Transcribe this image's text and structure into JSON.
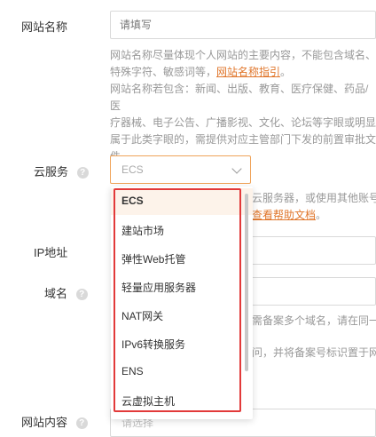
{
  "form": {
    "site_name": {
      "label": "网站名称",
      "placeholder": "请填写",
      "desc_lines": [
        "网站名称尽量体现个人网站的主要内容，不能包含域名、",
        "特殊字符、敏感词等，",
        "网站名称若包含：新闻、出版、教育、医疗保健、药品/医",
        "疗器械、电子公告、广播影视、文化、论坛等字眼或明显",
        "属于此类字眼的，需提供对应主管部门下发的前置审批文",
        "件。"
      ],
      "desc_link": "网站名称指引",
      "desc_link_suffix": "。"
    },
    "cloud_service": {
      "label": "云服务",
      "help_icon": "?",
      "selected": "ECS",
      "desc_line1_visible": "云服务器，或使用其他账号",
      "desc_line2_link_visible": "查看帮助文档",
      "desc_line2_suffix": "。"
    },
    "ip_address": {
      "label": "IP地址"
    },
    "domain": {
      "label": "域名",
      "help_icon": "?",
      "desc_line1_visible": "需备案多个域名，请在同一",
      "desc_line2_visible": "问，并将备案号标识置于网"
    },
    "site_content": {
      "label": "网站内容",
      "help_icon": "?",
      "placeholder": "请选择"
    }
  },
  "dropdown": {
    "options": [
      "ECS",
      "建站市场",
      "弹性Web托管",
      "轻量应用服务器",
      "NAT网关",
      "IPv6转换服务",
      "ENS",
      "云虚拟主机"
    ],
    "selected_index": 0
  },
  "colors": {
    "accent": "#e0762b",
    "focus_border": "#f0a45a",
    "highlight_box": "#e23a3a",
    "selected_row_bg": "#fdf3ea"
  },
  "icons": {
    "help": "question-circle-icon",
    "chevron": "chevron-down-icon"
  }
}
